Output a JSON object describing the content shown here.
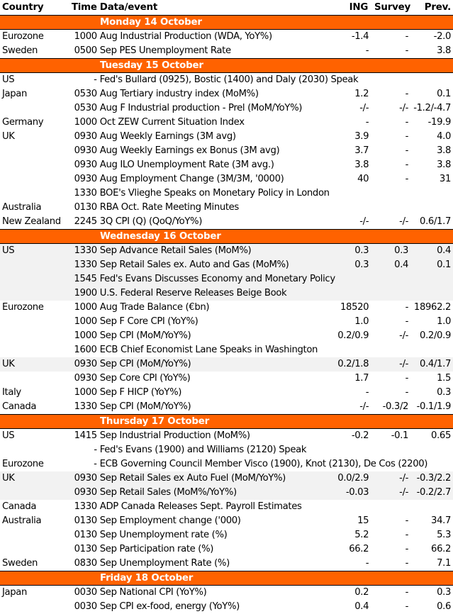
{
  "header": {
    "country": "Country",
    "time": "Time",
    "event": "Data/event",
    "ing": "ING",
    "survey": "Survey",
    "prev": "Prev."
  },
  "days": [
    {
      "label": "Monday 14 October",
      "rows": [
        {
          "country": "Eurozone",
          "time": "1000",
          "event": "Aug Industrial Production (WDA, YoY%)",
          "ing": "-1.4",
          "survey": "-",
          "prev": "-2.0",
          "highlight": false
        },
        {
          "country": "Sweden",
          "time": "0500",
          "event": "Sep PES Unemployment Rate",
          "ing": "-",
          "survey": "-",
          "prev": "3.8",
          "highlight": false
        }
      ]
    },
    {
      "label": "Tuesday 15 October",
      "rows": [
        {
          "country": "US",
          "time": "-",
          "event": "Fed's Bullard (0925), Bostic (1400) and Daly (2030) Speak",
          "ing": "",
          "survey": "",
          "prev": "",
          "highlight": false
        },
        {
          "country": "Japan",
          "time": "0530",
          "event": "Aug Tertiary industry index (MoM%)",
          "ing": "1.2",
          "survey": "-",
          "prev": "0.1",
          "highlight": false
        },
        {
          "country": "",
          "time": "0530",
          "event": "Aug F Industrial production - Prel (MoM/YoY%)",
          "ing": "-/-",
          "survey": "-/-",
          "prev": "-1.2/-4.7",
          "highlight": false
        },
        {
          "country": "Germany",
          "time": "1000",
          "event": "Oct ZEW Current Situation Index",
          "ing": "-",
          "survey": "-",
          "prev": "-19.9",
          "highlight": false
        },
        {
          "country": "UK",
          "time": "0930",
          "event": "Aug Weekly Earnings (3M avg)",
          "ing": "3.9",
          "survey": "-",
          "prev": "4.0",
          "highlight": false
        },
        {
          "country": "",
          "time": "0930",
          "event": "Aug Weekly Earnings ex Bonus (3M avg)",
          "ing": "3.7",
          "survey": "-",
          "prev": "3.8",
          "highlight": false
        },
        {
          "country": "",
          "time": "0930",
          "event": "Aug ILO Unemployment Rate (3M avg.)",
          "ing": "3.8",
          "survey": "-",
          "prev": "3.8",
          "highlight": false
        },
        {
          "country": "",
          "time": "0930",
          "event": "Aug Employment Change (3M/3M, '0000)",
          "ing": "40",
          "survey": "-",
          "prev": "31",
          "highlight": false
        },
        {
          "country": "",
          "time": "1330",
          "event": "BOE's Vlieghe Speaks on Monetary Policy in London",
          "ing": "",
          "survey": "",
          "prev": "",
          "highlight": false
        },
        {
          "country": "Australia",
          "time": "0130",
          "event": "RBA Oct. Rate Meeting Minutes",
          "ing": "",
          "survey": "",
          "prev": "",
          "highlight": false
        },
        {
          "country": "New Zealand",
          "time": "2245",
          "event": "3Q CPI (Q) (QoQ/YoY%)",
          "ing": "-/-",
          "survey": "-/-",
          "prev": "0.6/1.7",
          "highlight": false
        }
      ]
    },
    {
      "label": "Wednesday 16 October",
      "rows": [
        {
          "country": "US",
          "time": "1330",
          "event": "Sep Advance Retail Sales (MoM%)",
          "ing": "0.3",
          "survey": "0.3",
          "prev": "0.4",
          "highlight": true
        },
        {
          "country": "",
          "time": "1330",
          "event": "Sep Retail Sales ex. Auto and Gas (MoM%)",
          "ing": "0.3",
          "survey": "0.4",
          "prev": "0.1",
          "highlight": true
        },
        {
          "country": "",
          "time": "1545",
          "event": "Fed's Evans Discusses Economy and Monetary Policy",
          "ing": "",
          "survey": "",
          "prev": "",
          "highlight": true
        },
        {
          "country": "",
          "time": "1900",
          "event": "U.S. Federal Reserve Releases Beige Book",
          "ing": "",
          "survey": "",
          "prev": "",
          "highlight": true
        },
        {
          "country": "Eurozone",
          "time": "1000",
          "event": "Aug Trade Balance (€bn)",
          "ing": "18520",
          "survey": "-",
          "prev": "18962.2",
          "highlight": false
        },
        {
          "country": "",
          "time": "1000",
          "event": "Sep F Core CPI (YoY%)",
          "ing": "1.0",
          "survey": "-",
          "prev": "1.0",
          "highlight": false
        },
        {
          "country": "",
          "time": "1000",
          "event": "Sep CPI (MoM/YoY%)",
          "ing": "0.2/0.9",
          "survey": "-/-",
          "prev": "0.2/0.9",
          "highlight": false
        },
        {
          "country": "",
          "time": "1600",
          "event": "ECB Chief Economist Lane Speaks in Washington",
          "ing": "",
          "survey": "",
          "prev": "",
          "highlight": false
        },
        {
          "country": "UK",
          "time": "0930",
          "event": "Sep CPI (MoM/YoY%)",
          "ing": "0.2/1.8",
          "survey": "-/-",
          "prev": "0.4/1.7",
          "highlight": true
        },
        {
          "country": "",
          "time": "0930",
          "event": "Sep Core CPI (YoY%)",
          "ing": "1.7",
          "survey": "-",
          "prev": "1.5",
          "highlight": false
        },
        {
          "country": "Italy",
          "time": "1000",
          "event": "Sep F HICP (YoY%)",
          "ing": "-",
          "survey": "-",
          "prev": "0.3",
          "highlight": false
        },
        {
          "country": "Canada",
          "time": "1330",
          "event": "Sep CPI (MoM/YoY%)",
          "ing": "-/-",
          "survey": "-0.3/2",
          "prev": "-0.1/1.9",
          "highlight": false
        }
      ]
    },
    {
      "label": "Thursday 17 October",
      "rows": [
        {
          "country": "US",
          "time": "1415",
          "event": "Sep Industrial Production (MoM%)",
          "ing": "-0.2",
          "survey": "-0.1",
          "prev": "0.65",
          "highlight": false
        },
        {
          "country": "",
          "time": "-",
          "event": "Fed's Evans (1900) and Williams (2120) Speak",
          "ing": "",
          "survey": "",
          "prev": "",
          "highlight": false
        },
        {
          "country": "Eurozone",
          "time": "-",
          "event": "ECB Governing Council Member Visco (1900), Knot (2130), De Cos (2200)",
          "ing": "",
          "survey": "",
          "prev": "",
          "highlight": false
        },
        {
          "country": "UK",
          "time": "0930",
          "event": "Sep Retail Sales ex Auto Fuel (MoM/YoY%)",
          "ing": "0.0/2.9",
          "survey": "-/-",
          "prev": "-0.3/2.2",
          "highlight": true
        },
        {
          "country": "",
          "time": "0930",
          "event": "Sep Retail Sales (MoM%/YoY%)",
          "ing": "-0.03",
          "survey": "-/-",
          "prev": "-0.2/2.7",
          "highlight": true
        },
        {
          "country": "Canada",
          "time": "1330",
          "event": "ADP Canada Releases Sept. Payroll Estimates",
          "ing": "",
          "survey": "",
          "prev": "",
          "highlight": false
        },
        {
          "country": "Australia",
          "time": "0130",
          "event": "Sep Employment change ('000)",
          "ing": "15",
          "survey": "-",
          "prev": "34.7",
          "highlight": false
        },
        {
          "country": "",
          "time": "0130",
          "event": "Sep Unemployment rate (%)",
          "ing": "5.2",
          "survey": "-",
          "prev": "5.3",
          "highlight": false
        },
        {
          "country": "",
          "time": "0130",
          "event": "Sep Participation rate (%)",
          "ing": "66.2",
          "survey": "-",
          "prev": "66.2",
          "highlight": false
        },
        {
          "country": "Sweden",
          "time": "0830",
          "event": "Sep Unemployment Rate (%)",
          "ing": "-",
          "survey": "-",
          "prev": "7.1",
          "highlight": false
        }
      ]
    },
    {
      "label": "Friday 18 October",
      "rows": [
        {
          "country": "Japan",
          "time": "0030",
          "event": "Sep National CPI (YoY%)",
          "ing": "0.2",
          "survey": "-",
          "prev": "0.3",
          "highlight": false
        },
        {
          "country": "",
          "time": "0030",
          "event": "Sep CPI ex-food, energy (YoY%)",
          "ing": "0.4",
          "survey": "-",
          "prev": "0.6",
          "highlight": false
        }
      ]
    }
  ],
  "colors": {
    "day_bar": "#ff6200",
    "day_text": "#ffffff",
    "highlight_row": "#f2f2f2"
  }
}
